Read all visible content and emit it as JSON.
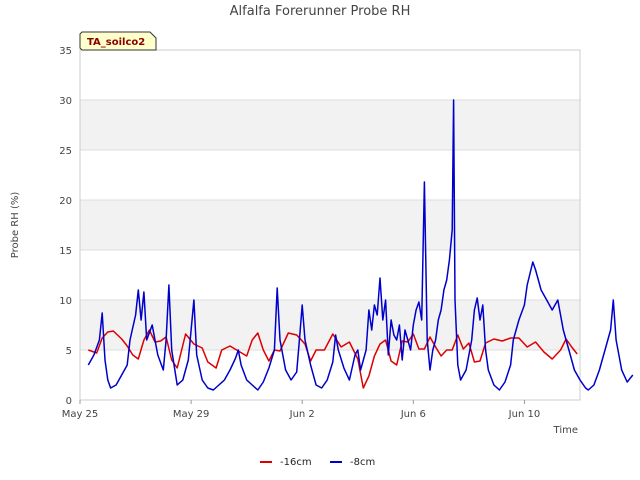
{
  "chart_data": {
    "type": "line",
    "title": "Alfalfa Forerunner Probe RH",
    "xlabel": "Time",
    "ylabel": "Probe RH (%)",
    "badge": "TA_soilco2",
    "ylim": [
      0,
      35
    ],
    "yticks": [
      0,
      5,
      10,
      15,
      20,
      25,
      30,
      35
    ],
    "xlim": [
      0,
      18
    ],
    "x_unit": "days since May 25",
    "xticks": [
      {
        "label": "May 25",
        "value": 0
      },
      {
        "label": "May 29",
        "value": 4
      },
      {
        "label": "Jun 2",
        "value": 8
      },
      {
        "label": "Jun 6",
        "value": 12
      },
      {
        "label": "Jun 10",
        "value": 16
      }
    ],
    "grid": true,
    "legend_position": "bottom",
    "series": [
      {
        "name": "-16cm",
        "color": "#dd0000",
        "points": [
          [
            0.3,
            5.0
          ],
          [
            0.6,
            4.7
          ],
          [
            0.8,
            6.2
          ],
          [
            1.0,
            6.8
          ],
          [
            1.2,
            6.9
          ],
          [
            1.5,
            6.1
          ],
          [
            1.7,
            5.4
          ],
          [
            1.9,
            4.5
          ],
          [
            2.1,
            4.1
          ],
          [
            2.3,
            6.0
          ],
          [
            2.5,
            7.0
          ],
          [
            2.7,
            5.8
          ],
          [
            2.9,
            5.9
          ],
          [
            3.1,
            6.3
          ],
          [
            3.3,
            4.0
          ],
          [
            3.5,
            3.2
          ],
          [
            3.8,
            6.6
          ],
          [
            4.1,
            5.6
          ],
          [
            4.4,
            5.2
          ],
          [
            4.6,
            3.8
          ],
          [
            4.9,
            3.2
          ],
          [
            5.1,
            5.0
          ],
          [
            5.4,
            5.4
          ],
          [
            5.7,
            4.9
          ],
          [
            6.0,
            4.4
          ],
          [
            6.2,
            6.0
          ],
          [
            6.4,
            6.7
          ],
          [
            6.6,
            5.0
          ],
          [
            6.8,
            3.9
          ],
          [
            7.0,
            5.0
          ],
          [
            7.2,
            4.9
          ],
          [
            7.5,
            6.7
          ],
          [
            7.8,
            6.5
          ],
          [
            8.1,
            5.6
          ],
          [
            8.3,
            3.9
          ],
          [
            8.5,
            5.0
          ],
          [
            8.8,
            5.0
          ],
          [
            9.1,
            6.6
          ],
          [
            9.4,
            5.3
          ],
          [
            9.7,
            5.8
          ],
          [
            10.0,
            4.1
          ],
          [
            10.2,
            1.2
          ],
          [
            10.4,
            2.4
          ],
          [
            10.6,
            4.4
          ],
          [
            10.8,
            5.6
          ],
          [
            11.0,
            6.0
          ],
          [
            11.2,
            3.9
          ],
          [
            11.4,
            3.5
          ],
          [
            11.6,
            5.9
          ],
          [
            11.8,
            5.8
          ],
          [
            12.0,
            6.6
          ],
          [
            12.2,
            5.1
          ],
          [
            12.4,
            5.1
          ],
          [
            12.6,
            6.3
          ],
          [
            12.8,
            5.3
          ],
          [
            13.0,
            4.4
          ],
          [
            13.2,
            5.0
          ],
          [
            13.4,
            5.0
          ],
          [
            13.6,
            6.5
          ],
          [
            13.8,
            5.1
          ],
          [
            14.0,
            5.7
          ],
          [
            14.2,
            3.8
          ],
          [
            14.4,
            3.9
          ],
          [
            14.6,
            5.7
          ],
          [
            14.9,
            6.1
          ],
          [
            15.2,
            5.9
          ],
          [
            15.5,
            6.2
          ],
          [
            15.8,
            6.2
          ],
          [
            16.1,
            5.3
          ],
          [
            16.4,
            5.8
          ],
          [
            16.7,
            4.8
          ],
          [
            17.0,
            4.1
          ],
          [
            17.3,
            5.0
          ],
          [
            17.5,
            6.1
          ],
          [
            17.7,
            5.3
          ],
          [
            17.9,
            4.6
          ]
        ]
      },
      {
        "name": "-8cm",
        "color": "#0000cc",
        "points": [
          [
            0.3,
            3.5
          ],
          [
            0.5,
            4.5
          ],
          [
            0.7,
            6.0
          ],
          [
            0.8,
            8.7
          ],
          [
            0.9,
            4.0
          ],
          [
            1.0,
            2.0
          ],
          [
            1.1,
            1.2
          ],
          [
            1.3,
            1.5
          ],
          [
            1.5,
            2.5
          ],
          [
            1.7,
            3.5
          ],
          [
            1.8,
            6.0
          ],
          [
            2.0,
            8.5
          ],
          [
            2.1,
            11.0
          ],
          [
            2.2,
            8.0
          ],
          [
            2.3,
            10.8
          ],
          [
            2.4,
            6.0
          ],
          [
            2.6,
            7.5
          ],
          [
            2.8,
            4.5
          ],
          [
            3.0,
            3.0
          ],
          [
            3.1,
            6.0
          ],
          [
            3.2,
            11.5
          ],
          [
            3.3,
            5.0
          ],
          [
            3.5,
            1.5
          ],
          [
            3.7,
            2.0
          ],
          [
            3.9,
            4.0
          ],
          [
            4.0,
            7.0
          ],
          [
            4.1,
            10.0
          ],
          [
            4.2,
            4.5
          ],
          [
            4.4,
            2.0
          ],
          [
            4.6,
            1.2
          ],
          [
            4.8,
            1.0
          ],
          [
            5.0,
            1.5
          ],
          [
            5.2,
            2.0
          ],
          [
            5.4,
            3.0
          ],
          [
            5.6,
            4.2
          ],
          [
            5.7,
            5.0
          ],
          [
            5.8,
            3.5
          ],
          [
            6.0,
            2.0
          ],
          [
            6.2,
            1.5
          ],
          [
            6.4,
            1.0
          ],
          [
            6.6,
            1.8
          ],
          [
            6.8,
            3.2
          ],
          [
            7.0,
            5.0
          ],
          [
            7.1,
            11.2
          ],
          [
            7.2,
            6.0
          ],
          [
            7.4,
            3.0
          ],
          [
            7.6,
            2.0
          ],
          [
            7.8,
            2.8
          ],
          [
            7.9,
            6.0
          ],
          [
            8.0,
            9.5
          ],
          [
            8.1,
            6.0
          ],
          [
            8.3,
            3.5
          ],
          [
            8.5,
            1.5
          ],
          [
            8.7,
            1.2
          ],
          [
            8.9,
            2.0
          ],
          [
            9.1,
            3.8
          ],
          [
            9.2,
            6.5
          ],
          [
            9.3,
            5.0
          ],
          [
            9.5,
            3.2
          ],
          [
            9.7,
            2.0
          ],
          [
            9.9,
            4.5
          ],
          [
            10.0,
            5.0
          ],
          [
            10.1,
            3.0
          ],
          [
            10.3,
            5.0
          ],
          [
            10.4,
            9.0
          ],
          [
            10.5,
            7.0
          ],
          [
            10.6,
            9.5
          ],
          [
            10.7,
            8.5
          ],
          [
            10.8,
            12.2
          ],
          [
            10.9,
            8.0
          ],
          [
            11.0,
            10.0
          ],
          [
            11.1,
            4.5
          ],
          [
            11.2,
            8.0
          ],
          [
            11.3,
            6.5
          ],
          [
            11.4,
            6.0
          ],
          [
            11.5,
            7.5
          ],
          [
            11.6,
            4.0
          ],
          [
            11.7,
            7.0
          ],
          [
            11.8,
            6.0
          ],
          [
            11.9,
            5.0
          ],
          [
            12.0,
            7.5
          ],
          [
            12.1,
            9.0
          ],
          [
            12.2,
            9.8
          ],
          [
            12.3,
            8.0
          ],
          [
            12.4,
            21.8
          ],
          [
            12.5,
            6.0
          ],
          [
            12.6,
            3.0
          ],
          [
            12.7,
            5.0
          ],
          [
            12.8,
            6.0
          ],
          [
            12.9,
            8.0
          ],
          [
            13.0,
            9.0
          ],
          [
            13.1,
            11.0
          ],
          [
            13.2,
            12.0
          ],
          [
            13.3,
            14.0
          ],
          [
            13.4,
            17.0
          ],
          [
            13.45,
            30.0
          ],
          [
            13.5,
            10.0
          ],
          [
            13.6,
            3.5
          ],
          [
            13.7,
            2.0
          ],
          [
            13.9,
            3.0
          ],
          [
            14.1,
            6.0
          ],
          [
            14.2,
            9.0
          ],
          [
            14.3,
            10.2
          ],
          [
            14.4,
            8.0
          ],
          [
            14.5,
            9.5
          ],
          [
            14.6,
            5.0
          ],
          [
            14.7,
            3.0
          ],
          [
            14.9,
            1.5
          ],
          [
            15.1,
            1.0
          ],
          [
            15.3,
            1.8
          ],
          [
            15.5,
            3.5
          ],
          [
            15.6,
            6.0
          ],
          [
            15.8,
            8.0
          ],
          [
            16.0,
            9.5
          ],
          [
            16.1,
            11.5
          ],
          [
            16.3,
            13.8
          ],
          [
            16.4,
            13.0
          ],
          [
            16.6,
            11.0
          ],
          [
            16.8,
            10.0
          ],
          [
            17.0,
            9.0
          ],
          [
            17.2,
            10.0
          ],
          [
            17.4,
            7.0
          ],
          [
            17.6,
            5.0
          ],
          [
            17.8,
            3.0
          ],
          [
            18.0,
            2.0
          ],
          [
            18.2,
            1.2
          ],
          [
            18.3,
            1.0
          ],
          [
            18.5,
            1.5
          ],
          [
            18.7,
            3.0
          ],
          [
            18.9,
            5.0
          ],
          [
            19.1,
            7.0
          ],
          [
            19.2,
            10.0
          ],
          [
            19.3,
            6.0
          ],
          [
            19.5,
            3.0
          ],
          [
            19.7,
            1.8
          ],
          [
            19.9,
            2.5
          ]
        ]
      }
    ]
  }
}
